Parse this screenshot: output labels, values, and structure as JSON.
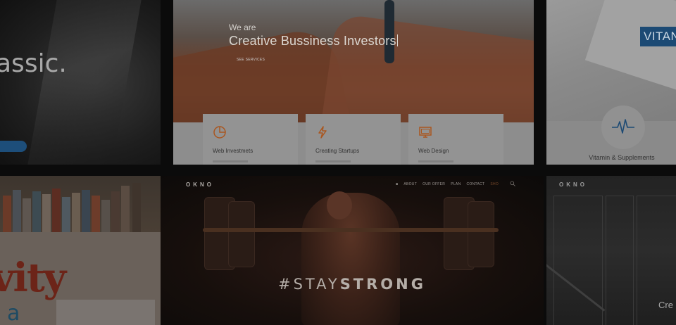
{
  "tiles": {
    "classic": {
      "headline": "assic."
    },
    "investors": {
      "pretitle": "We are",
      "title": "Creative Bussiness Investors",
      "link": "SEE SERVICES",
      "cards": [
        {
          "label": "Web Investmets",
          "icon": "pie-chart-icon"
        },
        {
          "label": "Creating Startups",
          "icon": "lightning-icon"
        },
        {
          "label": "Web Design",
          "icon": "monitor-icon"
        }
      ],
      "accent": "#c1642a"
    },
    "vitamin": {
      "tag": "VITAN",
      "label": "Vitamin & Supplements",
      "icon": "heartbeat-icon",
      "accent": "#1c4a74"
    },
    "creativity": {
      "word": "vity",
      "glyph": "a"
    },
    "okno": {
      "logo": "OKNO",
      "nav": [
        "ABOUT",
        "OUR OFFER",
        "PLAN",
        "CONTACT",
        "SHO"
      ],
      "hashtag_light": "#STAY",
      "hashtag_bold": "STRONG"
    },
    "okno_city": {
      "logo": "OKNO",
      "text": "Cre"
    }
  }
}
